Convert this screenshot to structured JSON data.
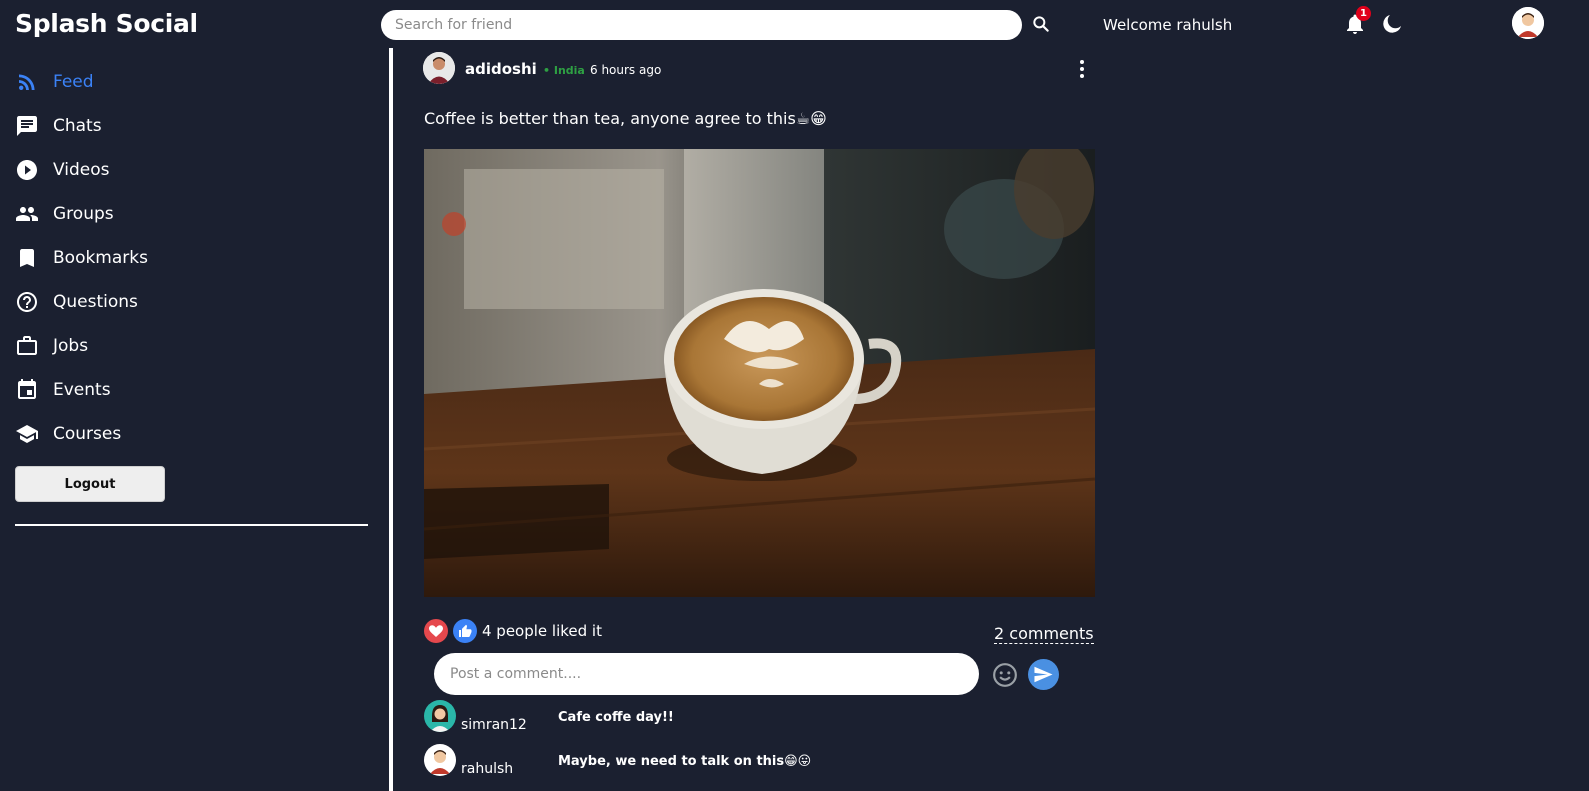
{
  "header": {
    "logo": "Splash Social",
    "search_placeholder": "Search for friend",
    "welcome": "Welcome rahulsh",
    "notification_count": "1"
  },
  "sidebar": {
    "items": [
      {
        "label": "Feed",
        "icon": "rss-icon",
        "active": true
      },
      {
        "label": "Chats",
        "icon": "chat-icon"
      },
      {
        "label": "Videos",
        "icon": "play-circle-icon"
      },
      {
        "label": "Groups",
        "icon": "group-icon"
      },
      {
        "label": "Bookmarks",
        "icon": "bookmark-icon"
      },
      {
        "label": "Questions",
        "icon": "help-circle-icon"
      },
      {
        "label": "Jobs",
        "icon": "briefcase-icon"
      },
      {
        "label": "Events",
        "icon": "calendar-icon"
      },
      {
        "label": "Courses",
        "icon": "school-icon"
      }
    ],
    "logout_label": "Logout"
  },
  "post": {
    "username": "adidoshi",
    "location": "• India",
    "time": "6 hours ago",
    "text": "Coffee is better than tea, anyone agree to this☕😁",
    "image_alt": "latte art coffee cup on wooden counter",
    "likes_text": "4 people liked it",
    "comments_link": "2 comments",
    "comment_placeholder": "Post a comment....",
    "comments": [
      {
        "user": "simran12",
        "text": "Cafe coffe day!!"
      },
      {
        "user": "rahulsh",
        "text": "Maybe, we need to talk on this😁😛"
      }
    ]
  },
  "colors": {
    "background": "#1b2030",
    "accent": "#3b82f6",
    "location_green": "#2ea043",
    "badge_red": "#e0001a",
    "heart_red": "#e5484d",
    "send_blue": "#4a90e2"
  }
}
